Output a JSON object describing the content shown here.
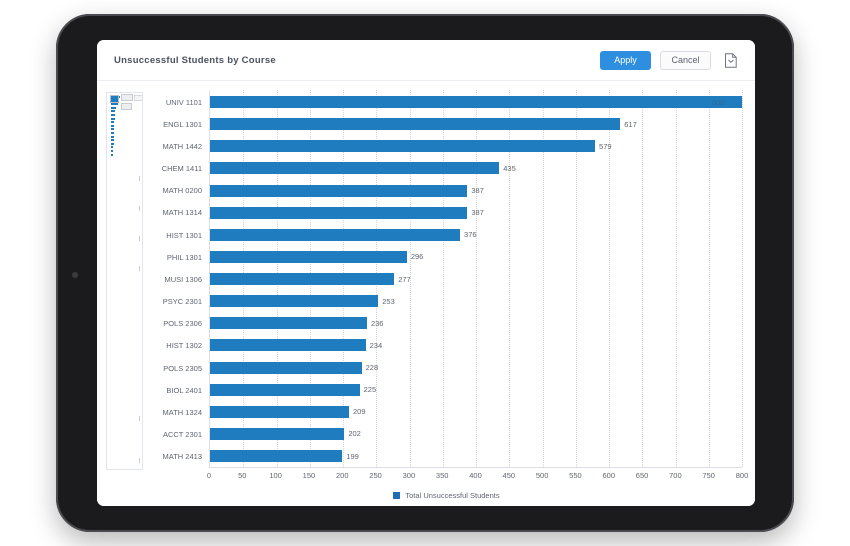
{
  "panel": {
    "title": "Unsuccessful Students by Course"
  },
  "toolbar": {
    "apply_label": "Apply",
    "cancel_label": "Cancel",
    "export_icon": "document-download-icon"
  },
  "colors": {
    "bar": "#1f7cbf",
    "apply_button": "#2e8fe0",
    "legend_swatch": "#1f6fb5",
    "device_bezel": "#1b1b1d"
  },
  "chart_data": {
    "type": "bar",
    "orientation": "horizontal",
    "title": "Unsuccessful Students by Course",
    "xlabel": "",
    "ylabel": "",
    "xlim": [
      0,
      800
    ],
    "xticks": [
      0,
      50,
      100,
      150,
      200,
      250,
      300,
      350,
      400,
      450,
      500,
      550,
      600,
      650,
      700,
      750,
      800
    ],
    "grid": true,
    "grid_axis": "x",
    "legend": [
      "Total Unsuccessful Students"
    ],
    "legend_position": "bottom-center",
    "data_labels": true,
    "categories": [
      "UNIV 1101",
      "ENGL 1301",
      "MATH 1442",
      "CHEM 1411",
      "MATH 0200",
      "MATH 1314",
      "HIST 1301",
      "PHIL 1301",
      "MUSI 1306",
      "PSYC 2301",
      "POLS 2306",
      "HIST 1302",
      "POLS 2305",
      "BIOL 2401",
      "MATH 1324",
      "ACCT 2301",
      "MATH 2413"
    ],
    "series": [
      {
        "name": "Total Unsuccessful Students",
        "values": [
          800,
          617,
          579,
          435,
          387,
          387,
          376,
          296,
          277,
          253,
          236,
          234,
          228,
          225,
          209,
          202,
          199
        ]
      }
    ]
  }
}
